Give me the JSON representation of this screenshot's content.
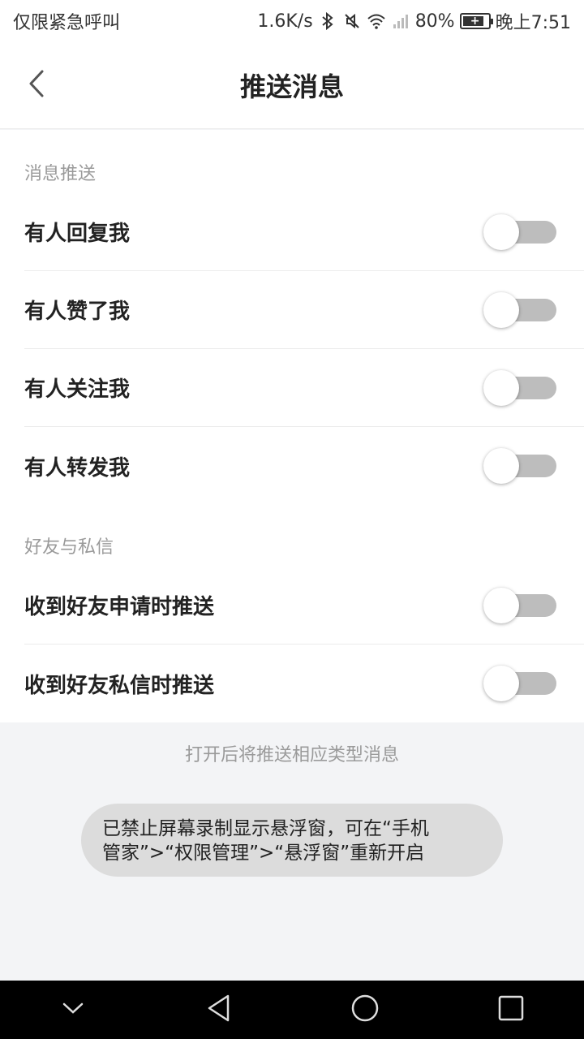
{
  "status_bar": {
    "left_text": "仅限紧急呼叫",
    "speed": "1.6K/s",
    "battery": "80%",
    "time": "晚上7:51",
    "icons": [
      "bluetooth-icon",
      "mute-icon",
      "wifi-icon",
      "signal-icon",
      "battery-icon"
    ]
  },
  "header": {
    "title": "推送消息",
    "back_icon": "chevron-left-icon"
  },
  "sections": [
    {
      "title": "消息推送",
      "items": [
        {
          "label": "有人回复我",
          "enabled": false
        },
        {
          "label": "有人赞了我",
          "enabled": false
        },
        {
          "label": "有人关注我",
          "enabled": false
        },
        {
          "label": "有人转发我",
          "enabled": false
        }
      ]
    },
    {
      "title": "好友与私信",
      "items": [
        {
          "label": "收到好友申请时推送",
          "enabled": false
        },
        {
          "label": "收到好友私信时推送",
          "enabled": false
        }
      ]
    }
  ],
  "footer_note": "打开后将推送相应类型消息",
  "toast": {
    "line1": "已禁止屏幕录制显示悬浮窗，可在“手机",
    "line2": "管家”>“权限管理”>“悬浮窗”重新开启"
  },
  "nav_bar": {
    "icons": [
      "chevron-down-icon",
      "back-triangle-icon",
      "home-circle-icon",
      "recents-square-icon"
    ]
  },
  "colors": {
    "toggle_off_track": "#bdbdbd",
    "text_primary": "#222222",
    "text_secondary": "#9a9a9a",
    "background": "#f3f4f6"
  }
}
